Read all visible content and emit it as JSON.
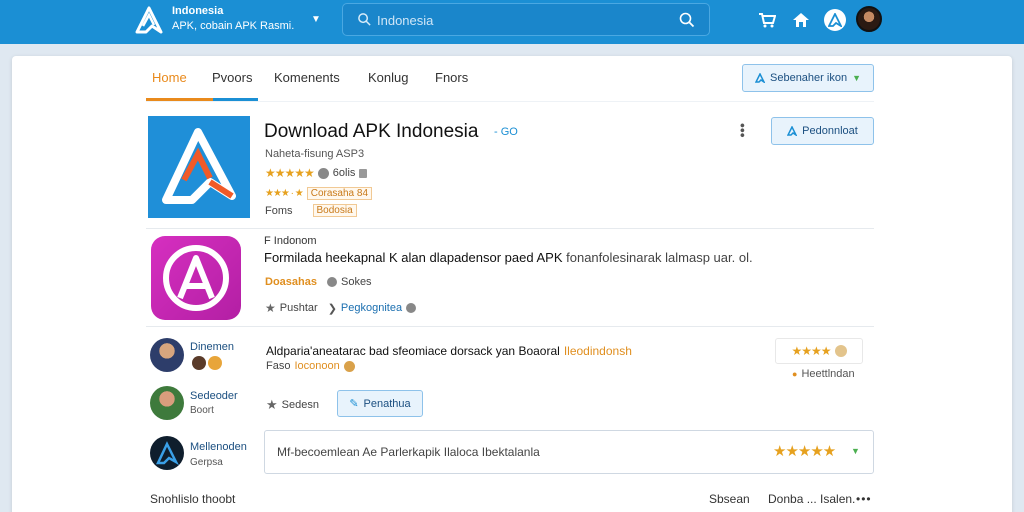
{
  "header": {
    "brand_title": "Indonesia",
    "brand_subtitle": "APK, cobain APK Rasmi.",
    "search_placeholder": "Indonesia"
  },
  "tabs": [
    {
      "label": "Home"
    },
    {
      "label": "Pvoors"
    },
    {
      "label": "Komenents"
    },
    {
      "label": "Konlug"
    },
    {
      "label": "Fnors"
    }
  ],
  "toolbar": {
    "select_label": "Sebenaher ikon"
  },
  "app1": {
    "title": "Download APK Indonesia",
    "title_suffix": "- GO",
    "subtitle": "Naheta-fisung ASP3",
    "rating_stars": "★★★★★",
    "rating_count": "6olis",
    "rating_small_stars": "★★★ · ★",
    "rating_tag": "Corasaha 84",
    "label_prefix": "Foms",
    "label_tag": "Bodosia",
    "download_label": "Pedonnloat"
  },
  "app2": {
    "label": "F Indonom",
    "description": "Formilada heekapnal K alan dlapadensor paed APK",
    "description_tail": "fonanfolesinarak lalmasp uar. ol.",
    "rating_label": "Doasahas",
    "rating_count": "Sokes",
    "action1": "Pushtar",
    "action2": "Pegkognitea"
  },
  "reviews": [
    {
      "name": "Dinemen",
      "text": "Aldparia'aneatarac bad sfeomiace dorsack yan Boaoral",
      "text_highlight": "Ileodindonsh",
      "sub": "Faso",
      "sub_highlight": "Ioconoon",
      "rating_stars": "★★★★",
      "rating_link": "Heettlndan"
    },
    {
      "name": "Sedeoder",
      "sub": "Boort",
      "action_label": "Sedesn",
      "button_label": "Penathua"
    },
    {
      "name": "Mellenoden",
      "sub": "Gerpsa",
      "comment": "Mf-becoemlean Ae Parlerkapik Ilaloca Ibektalanla"
    }
  ],
  "footer": {
    "left": "Snohlislo thoobt",
    "mid": "Sbsean",
    "right": "Donba ... Isalen."
  },
  "colors": {
    "topbar": "#1b8fd4",
    "accent_orange": "#e98a1c",
    "star": "#e6a11f",
    "app2_icon": "#c625b2"
  }
}
